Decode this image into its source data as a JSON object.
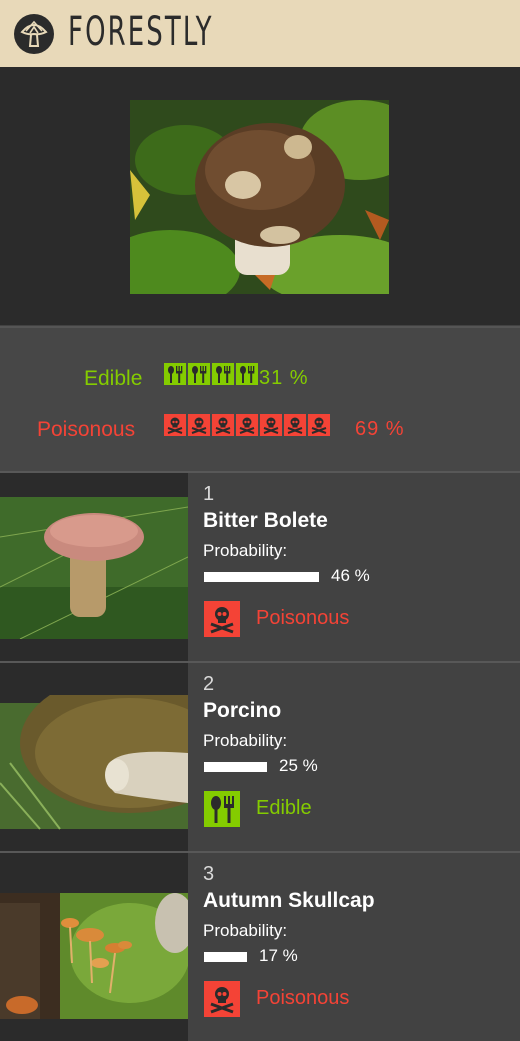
{
  "app": {
    "title": "FORESTLY"
  },
  "colors": {
    "edible": "#84cc00",
    "poisonous": "#f44336",
    "header_bg": "#e8d9b9"
  },
  "summary": {
    "edible": {
      "label": "Edible",
      "percent": "31 %",
      "icon": "fork-spoon-icon",
      "count": 4
    },
    "poisonous": {
      "label": "Poisonous",
      "percent": "69 %",
      "icon": "skull-crossbones-icon",
      "count": 7
    }
  },
  "results": [
    {
      "rank": "1",
      "name": "Bitter Bolete",
      "probability_label": "Probability:",
      "probability": 0.46,
      "percent": "46 %",
      "class_label": "Poisonous",
      "class_icon": "skull-crossbones-icon"
    },
    {
      "rank": "2",
      "name": "Porcino",
      "probability_label": "Probability:",
      "probability": 0.25,
      "percent": "25 %",
      "class_label": "Edible",
      "class_icon": "fork-spoon-icon"
    },
    {
      "rank": "3",
      "name": "Autumn Skullcap",
      "probability_label": "Probability:",
      "probability": 0.17,
      "percent": "17 %",
      "class_label": "Poisonous",
      "class_icon": "skull-crossbones-icon"
    }
  ]
}
